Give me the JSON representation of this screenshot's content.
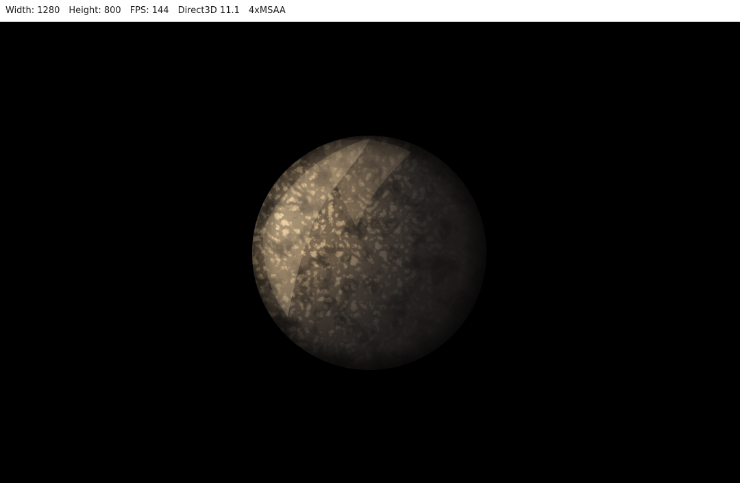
{
  "window": {
    "title_segments": [
      "Width: 1280",
      "Height: 800",
      "FPS: 144",
      "Direct3D 11.1",
      "4xMSAA"
    ]
  },
  "scene": {
    "background_color": "#000000",
    "planet": {
      "name": "rocky-planet",
      "lit_color": "#e6c79a",
      "shadow_color": "#121212"
    }
  }
}
